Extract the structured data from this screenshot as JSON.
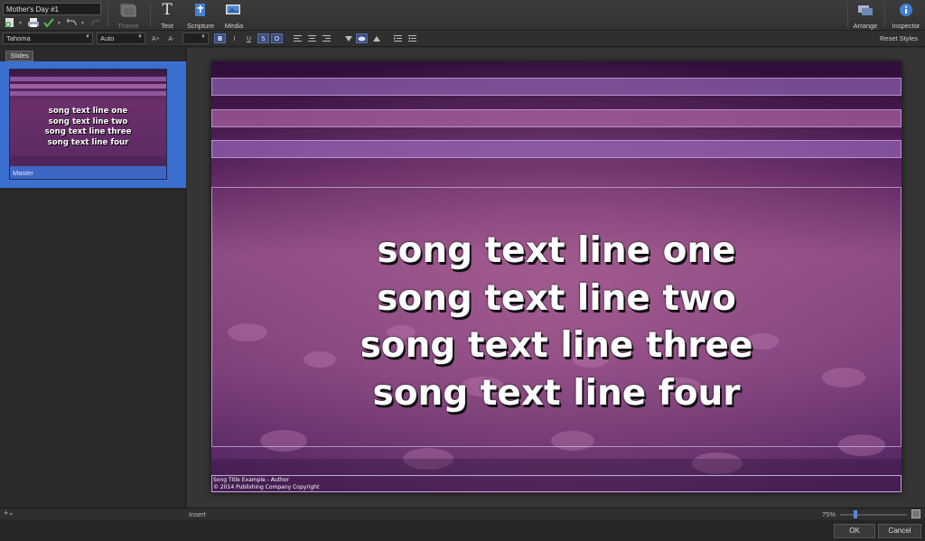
{
  "document": {
    "title": "Mother's Day #1"
  },
  "toolbar": {
    "theme_label": "Theme",
    "text_label": "Text",
    "scripture_label": "Scripture",
    "media_label": "Media",
    "arrange_label": "Arrange",
    "inspector_label": "Inspector"
  },
  "format": {
    "font_value": "Tahoma",
    "size_value": "Auto",
    "increase_label": "A",
    "decrease_label": "A",
    "bold_label": "B",
    "italic_label": "I",
    "underline_label": "U",
    "strike_label": "S",
    "outline_label": "O",
    "reset_label": "Reset Styles"
  },
  "sidebar": {
    "tab_label": "Slides",
    "slide_label": "Master",
    "add_label": "+"
  },
  "slide": {
    "lines": [
      "song text line one",
      "song text line two",
      "song text line three",
      "song text line four"
    ],
    "footer_line1": "Song Title Example - Author",
    "footer_line2": "© 2014 Publishing Company Copyright"
  },
  "status": {
    "mode": "Insert",
    "zoom": "75%"
  },
  "dialog": {
    "ok_label": "OK",
    "cancel_label": "Cancel"
  },
  "colors": {
    "accent": "#3b6fd0",
    "panel": "#2a2a2a",
    "slide_tint": "#7a3a7e"
  }
}
